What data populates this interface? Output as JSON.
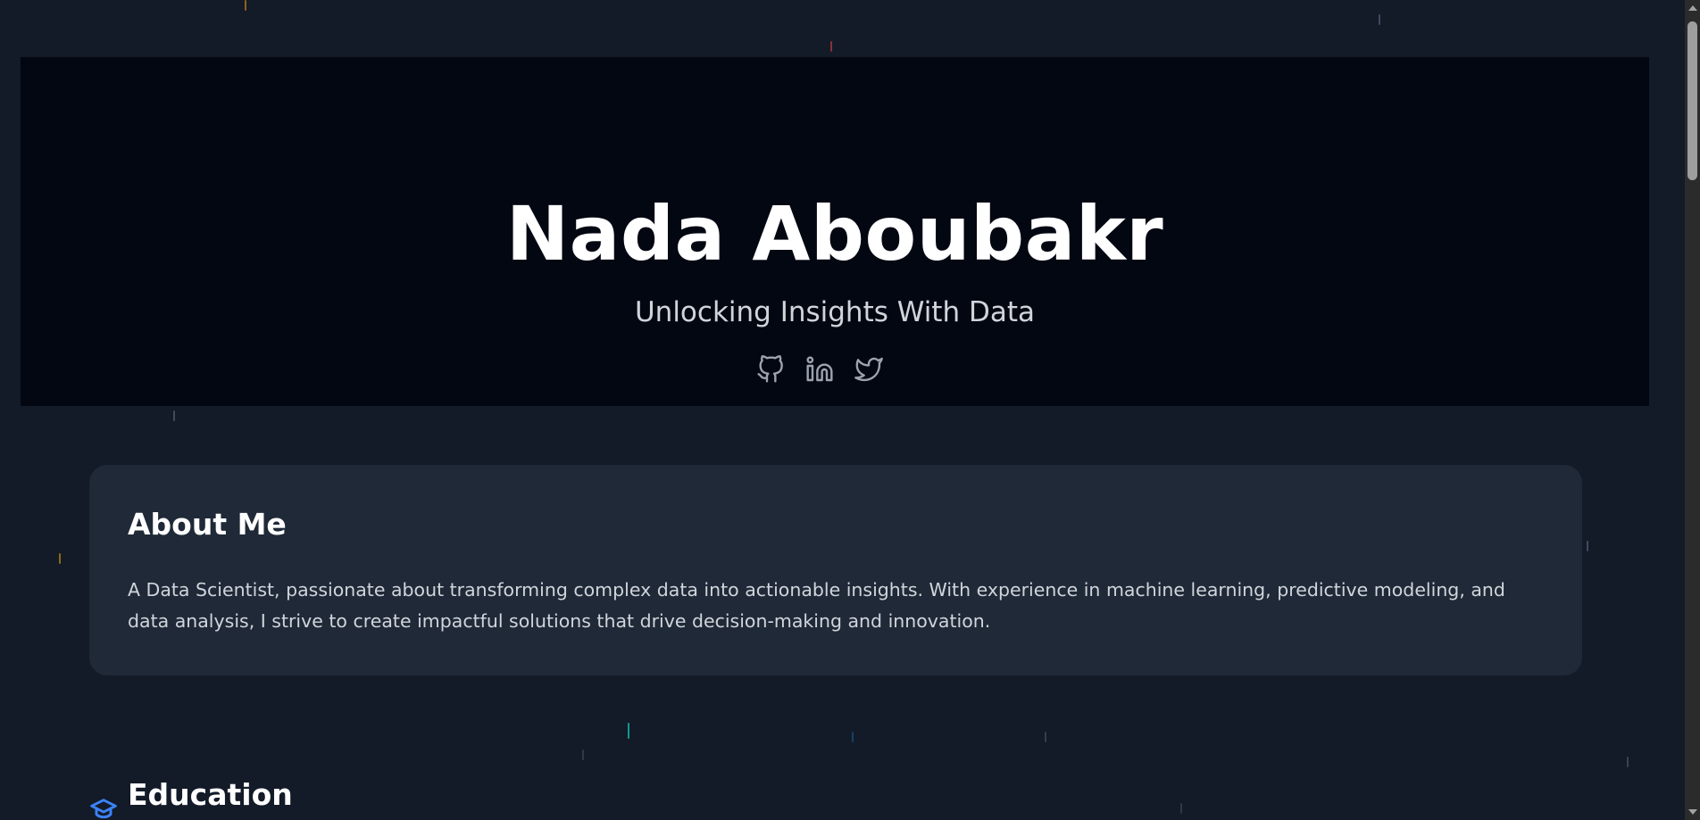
{
  "hero": {
    "name": "Nada Aboubakr",
    "tagline": "Unlocking Insights With Data",
    "socials": [
      {
        "icon": "github-icon"
      },
      {
        "icon": "linkedin-icon"
      },
      {
        "icon": "twitter-icon"
      }
    ]
  },
  "about": {
    "title": "About Me",
    "text": "A Data Scientist, passionate about transforming complex data into actionable insights. With experience in machine learning, predictive modeling, and data analysis, I strive to create impactful solutions that drive decision-making and innovation."
  },
  "education": {
    "title": "Education",
    "icon": "graduation-cap-icon"
  },
  "colors": {
    "page_background": "#131a28",
    "hero_background": "#030712",
    "card_background": "#1f2937",
    "accent": "#3b82f6"
  }
}
